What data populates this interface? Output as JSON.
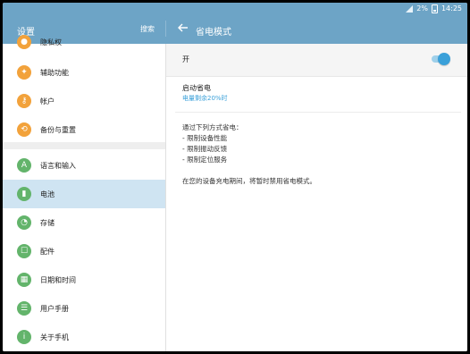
{
  "status": {
    "battery": "2%",
    "time": "14:25"
  },
  "header": {
    "left_title": "设置",
    "search": "搜索",
    "right_title": "省电模式"
  },
  "sidebar": {
    "items": [
      {
        "label": "隐私权",
        "icon": "privacy-icon",
        "color": "#f2a23b"
      },
      {
        "label": "辅助功能",
        "icon": "accessibility-icon",
        "color": "#f2a23b"
      },
      {
        "label": "帐户",
        "icon": "key-icon",
        "color": "#f2a23b"
      },
      {
        "label": "备份与重置",
        "icon": "backup-icon",
        "color": "#f2a23b"
      },
      {
        "label": "语言和输入",
        "icon": "language-icon",
        "color": "#63b46b"
      },
      {
        "label": "电池",
        "icon": "battery-icon",
        "color": "#63b46b",
        "selected": true
      },
      {
        "label": "存储",
        "icon": "storage-icon",
        "color": "#63b46b"
      },
      {
        "label": "配件",
        "icon": "accessory-icon",
        "color": "#63b46b"
      },
      {
        "label": "日期和时间",
        "icon": "calendar-icon",
        "color": "#63b46b"
      },
      {
        "label": "用户手册",
        "icon": "manual-icon",
        "color": "#63b46b"
      },
      {
        "label": "关于手机",
        "icon": "info-icon",
        "color": "#63b46b"
      }
    ]
  },
  "main": {
    "switch_label": "开",
    "switch_on": true,
    "start_title": "启动省电",
    "start_sub": "电量剩余20%时",
    "desc": {
      "line1": "通过下列方式省电：",
      "line2": "- 限制设备性能",
      "line3": "- 限制振动反馈",
      "line4": "- 限制定位服务"
    },
    "note": "在您的设备充电期间，将暂时禁用省电模式。"
  },
  "colors": {
    "header": "#6da4c6",
    "accent": "#3aa0d9",
    "selected": "#cfe4f2"
  }
}
